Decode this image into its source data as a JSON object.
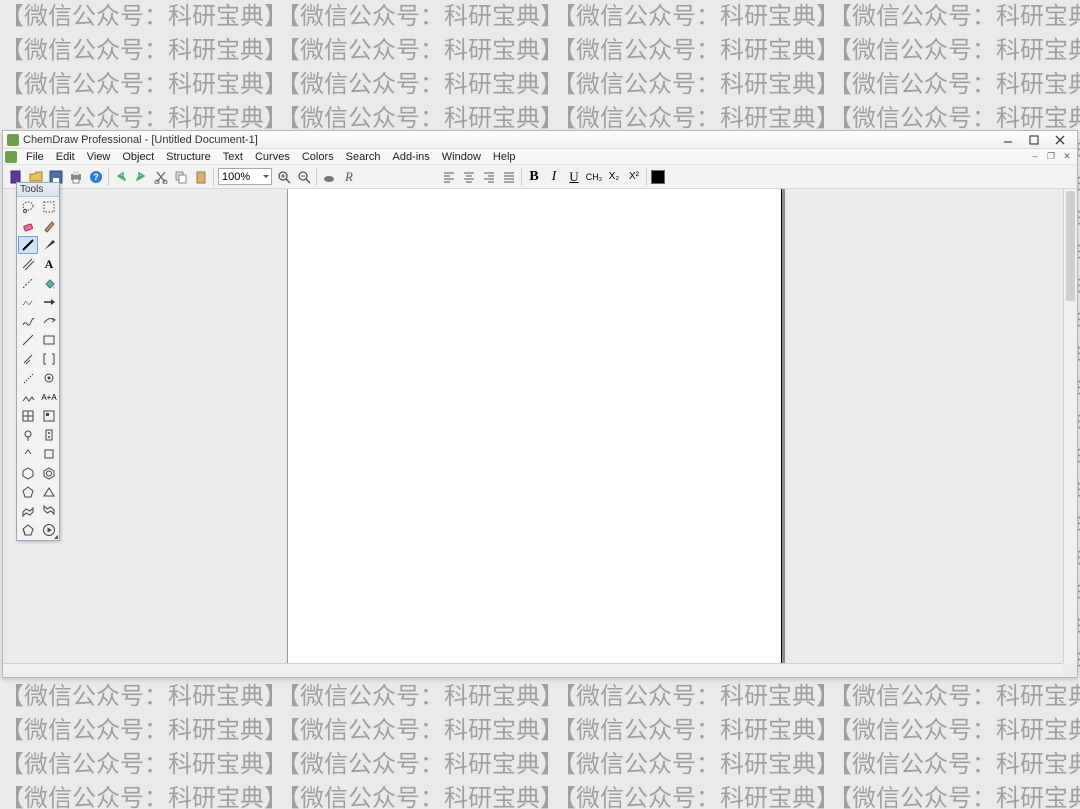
{
  "watermark": "【微信公众号：科研宝典】",
  "window": {
    "title": "ChemDraw Professional - [Untitled Document-1]",
    "minimize": "–",
    "maximize": "❐",
    "close": "✕"
  },
  "menu": {
    "items": [
      "File",
      "Edit",
      "View",
      "Object",
      "Structure",
      "Text",
      "Curves",
      "Colors",
      "Search",
      "Add-ins",
      "Window",
      "Help"
    ]
  },
  "toolbar": {
    "zoom": "100%",
    "bold": "B",
    "italic": "I",
    "underline": "U",
    "formula": "CH₂",
    "subscript": "X₂",
    "superscript": "X²",
    "R": "R"
  },
  "toolsPalette": {
    "title": "Tools",
    "tools": [
      "lasso",
      "marquee",
      "eraser",
      "pencil",
      "solid-bond",
      "wedge-bond",
      "bond",
      "text",
      "dashed-bond",
      "fill",
      "chain",
      "arrow",
      "wavy-bond",
      "reaction-arrow",
      "single-bond",
      "rectangle",
      "multi-bond",
      "bracket",
      "hash-bond",
      "orbital",
      "chain-tool",
      "label",
      "table",
      "template",
      "acyclic",
      "tlc",
      "ring-tool-open",
      "ring-tool",
      "cyclohexane",
      "benzene",
      "cyclopentane",
      "cyclopropane",
      "chair1",
      "chair2",
      "cyclopentadiene",
      "play"
    ]
  }
}
